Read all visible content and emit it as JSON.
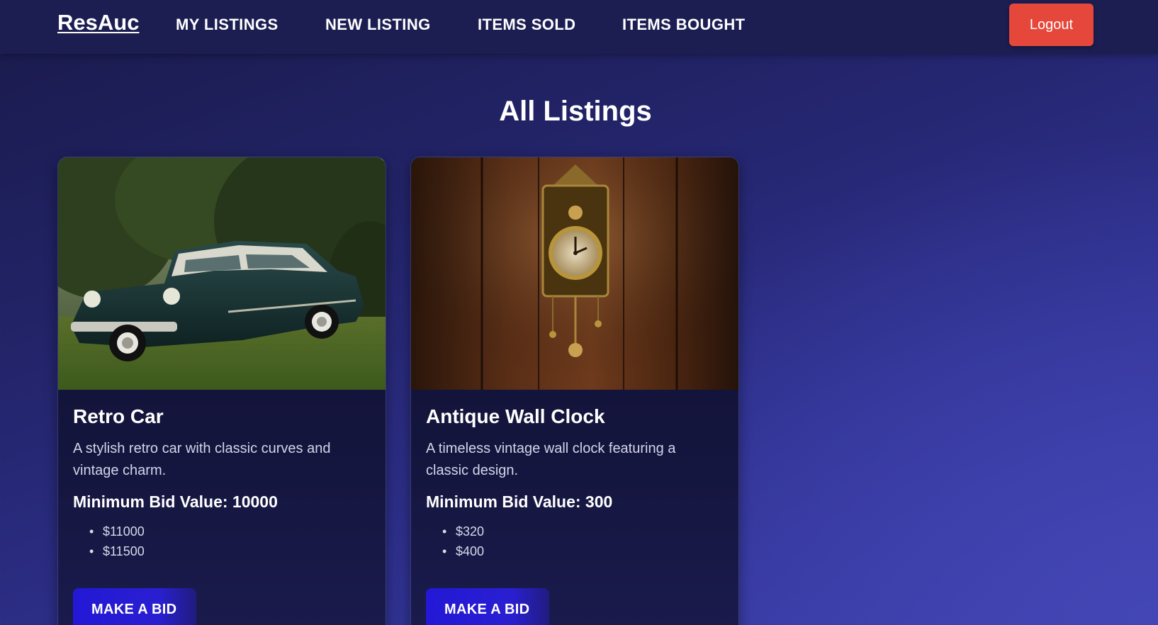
{
  "nav": {
    "brand": "ResAuc",
    "links": [
      "MY LISTINGS",
      "NEW LISTING",
      "ITEMS SOLD",
      "ITEMS BOUGHT"
    ],
    "logout_label": "Logout"
  },
  "page": {
    "title": "All Listings"
  },
  "colors": {
    "logout": "#e6473b",
    "bid_button": "#2318d6",
    "navbar": "#1c1e52"
  },
  "listings": [
    {
      "image": "retro-car-photo",
      "title": "Retro Car",
      "description": "A stylish retro car with classic curves and vintage charm.",
      "min_bid": "Minimum Bid Value: 10000",
      "bids": [
        "$11000",
        "$11500"
      ],
      "button_label": "MAKE A BID"
    },
    {
      "image": "antique-wall-clock-photo",
      "title": "Antique Wall Clock",
      "description": "A timeless vintage wall clock featuring a classic design.",
      "min_bid": "Minimum Bid Value: 300",
      "bids": [
        "$320",
        "$400"
      ],
      "button_label": "MAKE A BID"
    }
  ]
}
